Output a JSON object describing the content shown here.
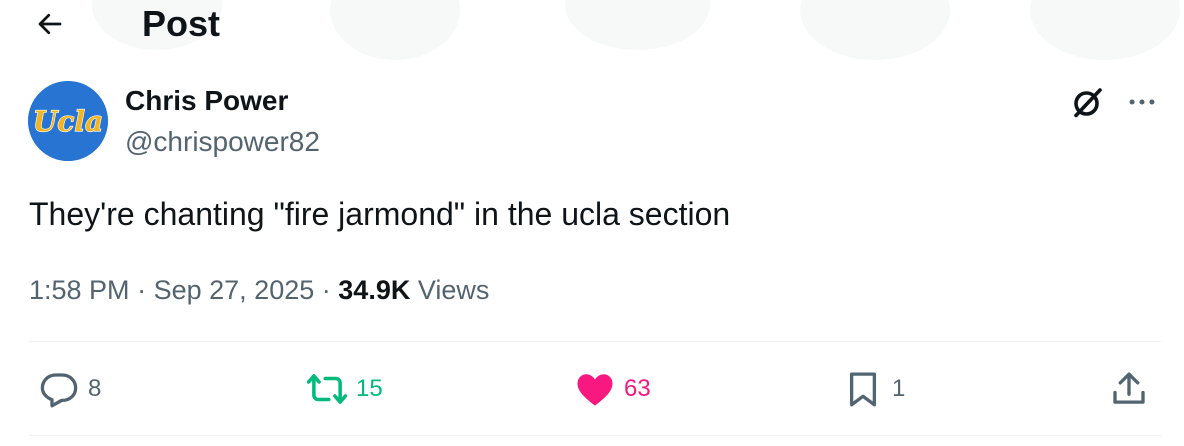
{
  "header": {
    "title": "Post"
  },
  "tweet": {
    "author": {
      "name": "Chris Power",
      "handle": "@chrispower82",
      "avatar_text": "Ucla"
    },
    "text": "They're chanting \"fire jarmond\" in the ucla section",
    "time": "1:58 PM",
    "separator": "·",
    "date": "Sep 27, 2025",
    "views_count": "34.9K",
    "views_label": "Views"
  },
  "actions": {
    "replies": "8",
    "reposts": "15",
    "likes": "63",
    "bookmarks": "1"
  },
  "colors": {
    "text": "#0f1419",
    "secondary": "#536471",
    "repost_active": "#00ba7c",
    "like_active": "#f91880",
    "avatar_bg": "#2774d2",
    "avatar_text": "#f2b522"
  },
  "icons": {
    "back": "arrow-left-icon",
    "grok": "grok-icon",
    "more": "more-icon",
    "reply": "reply-icon",
    "repost": "repost-icon",
    "like": "heart-icon",
    "bookmark": "bookmark-icon",
    "share": "share-icon"
  }
}
